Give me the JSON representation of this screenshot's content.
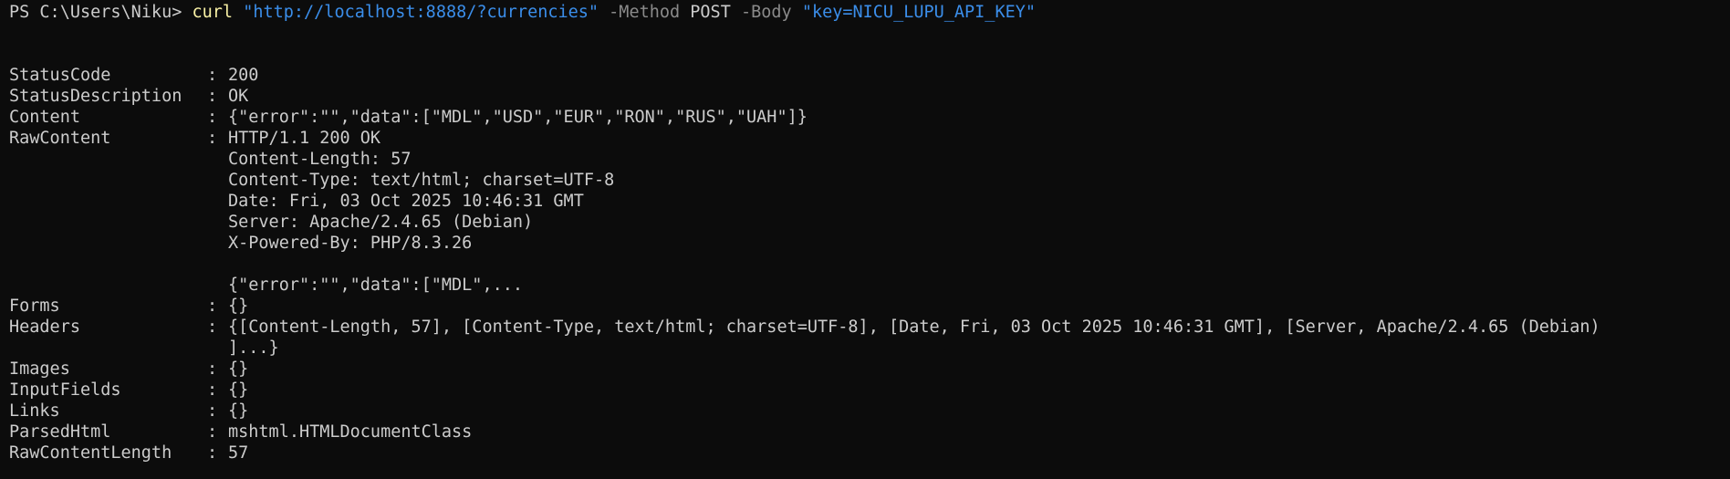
{
  "window": {
    "type": "PowerShell terminal"
  },
  "command": {
    "prompt": "PS C:\\Users\\Niku>",
    "cmdlet": "curl",
    "url": "\"http://localhost:8888/?currencies\"",
    "method_param": "-Method",
    "method_value": "POST",
    "body_param": "-Body",
    "body_value": "\"key=NICU_LUPU_API_KEY\""
  },
  "separator": ":",
  "response": {
    "status_code": {
      "key": "StatusCode",
      "value": "200"
    },
    "status_description": {
      "key": "StatusDescription",
      "value": "OK"
    },
    "content": {
      "key": "Content",
      "value": "{\"error\":\"\",\"data\":[\"MDL\",\"USD\",\"EUR\",\"RON\",\"RUS\",\"UAH\"]}"
    },
    "raw_content": {
      "key": "RawContent",
      "lines": [
        "HTTP/1.1 200 OK",
        "Content-Length: 57",
        "Content-Type: text/html; charset=UTF-8",
        "Date: Fri, 03 Oct 2025 10:46:31 GMT",
        "Server: Apache/2.4.65 (Debian)",
        "X-Powered-By: PHP/8.3.26",
        "",
        "{\"error\":\"\",\"data\":[\"MDL\",..."
      ]
    },
    "forms": {
      "key": "Forms",
      "value": "{}"
    },
    "headers": {
      "key": "Headers",
      "value": "{[Content-Length, 57], [Content-Type, text/html; charset=UTF-8], [Date, Fri, 03 Oct 2025 10:46:31 GMT], [Server, Apache/2.4.65 (Debian)",
      "continuation": "]...}"
    },
    "images": {
      "key": "Images",
      "value": "{}"
    },
    "input_fields": {
      "key": "InputFields",
      "value": "{}"
    },
    "links": {
      "key": "Links",
      "value": "{}"
    },
    "parsed_html": {
      "key": "ParsedHtml",
      "value": "mshtml.HTMLDocumentClass"
    },
    "raw_content_length": {
      "key": "RawContentLength",
      "value": "57"
    }
  },
  "colors": {
    "background": "#0c0c0c",
    "foreground": "#cccccc",
    "cmdlet": "#f9f1a5",
    "string": "#3b8eea",
    "parameter": "#8a8a8a"
  }
}
